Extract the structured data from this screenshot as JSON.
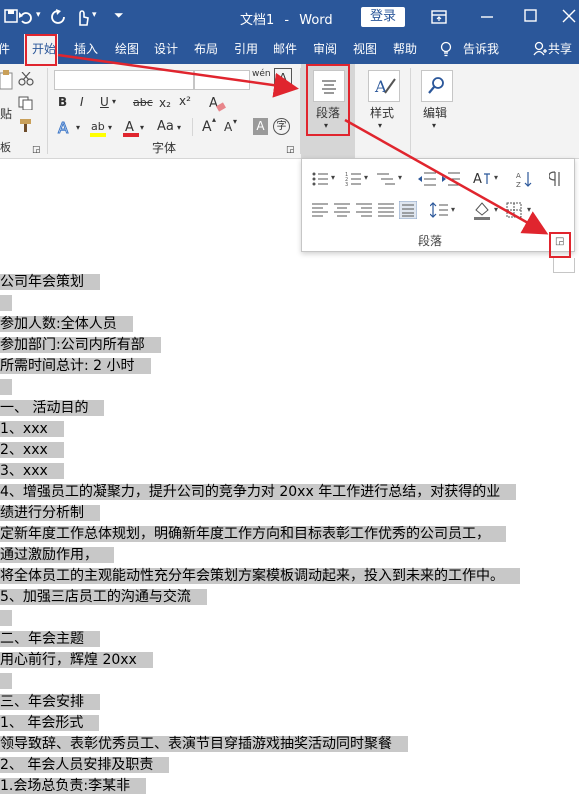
{
  "app": {
    "doc_title": "文档1",
    "separator": "-",
    "app_name": "Word",
    "login_label": "登录"
  },
  "tabs": {
    "file_fragment": "件",
    "home": "开始",
    "insert": "插入",
    "draw": "绘图",
    "design": "设计",
    "layout": "布局",
    "references": "引用",
    "mailings": "邮件",
    "review": "审阅",
    "view": "视图",
    "help": "帮助",
    "tellme": "告诉我",
    "share": "共享"
  },
  "ribbon": {
    "clipboard_fragment": "板",
    "paste_fragment": "贴",
    "font_group": "字体",
    "font_size_label": "wén",
    "paragraph_label": "段落",
    "styles_label": "样式",
    "editing_label": "编辑",
    "bold": "B",
    "italic": "I",
    "underline": "U",
    "strike": "abc",
    "sub": "x₂",
    "sup": "x²",
    "aa_label": "Aa",
    "grow": "A",
    "shrink": "A",
    "char_shade": "A",
    "char_border": "字"
  },
  "popup": {
    "group_label": "段落"
  },
  "document": {
    "lines": [
      "公司年会策划",
      "",
      "参加人数:全体人员",
      "参加部门:公司内所有部",
      "所需时间总计: 2 小时",
      "",
      "一、 活动目的",
      "1、xxx",
      "2、xxx",
      "3、xxx",
      "4、增强员工的凝聚力，提升公司的竞争力对 20xx 年工作进行总结，对获得的业",
      "绩进行分析制",
      "定新年度工作总体规划，明确新年度工作方向和目标表彰工作优秀的公司员工，",
      "通过激励作用，",
      "将全体员工的主观能动性充分年会策划方案模板调动起来，投入到未来的工作中。",
      "5、加强三店员工的沟通与交流",
      "",
      "二、年会主题",
      "用心前行，辉煌 20xx",
      "",
      "三、年会安排",
      "1、 年会形式",
      "领导致辞、表彰优秀员工、表演节目穿插游戏抽奖活动同时聚餐",
      "2、 年会人员安排及职责",
      "1.会场总负责:李某非"
    ]
  },
  "colors": {
    "word_blue": "#2b579a",
    "ribbon_bg": "#f3f3f3",
    "highlight": "#c8c8c8",
    "annotation_red": "#e0252e"
  }
}
